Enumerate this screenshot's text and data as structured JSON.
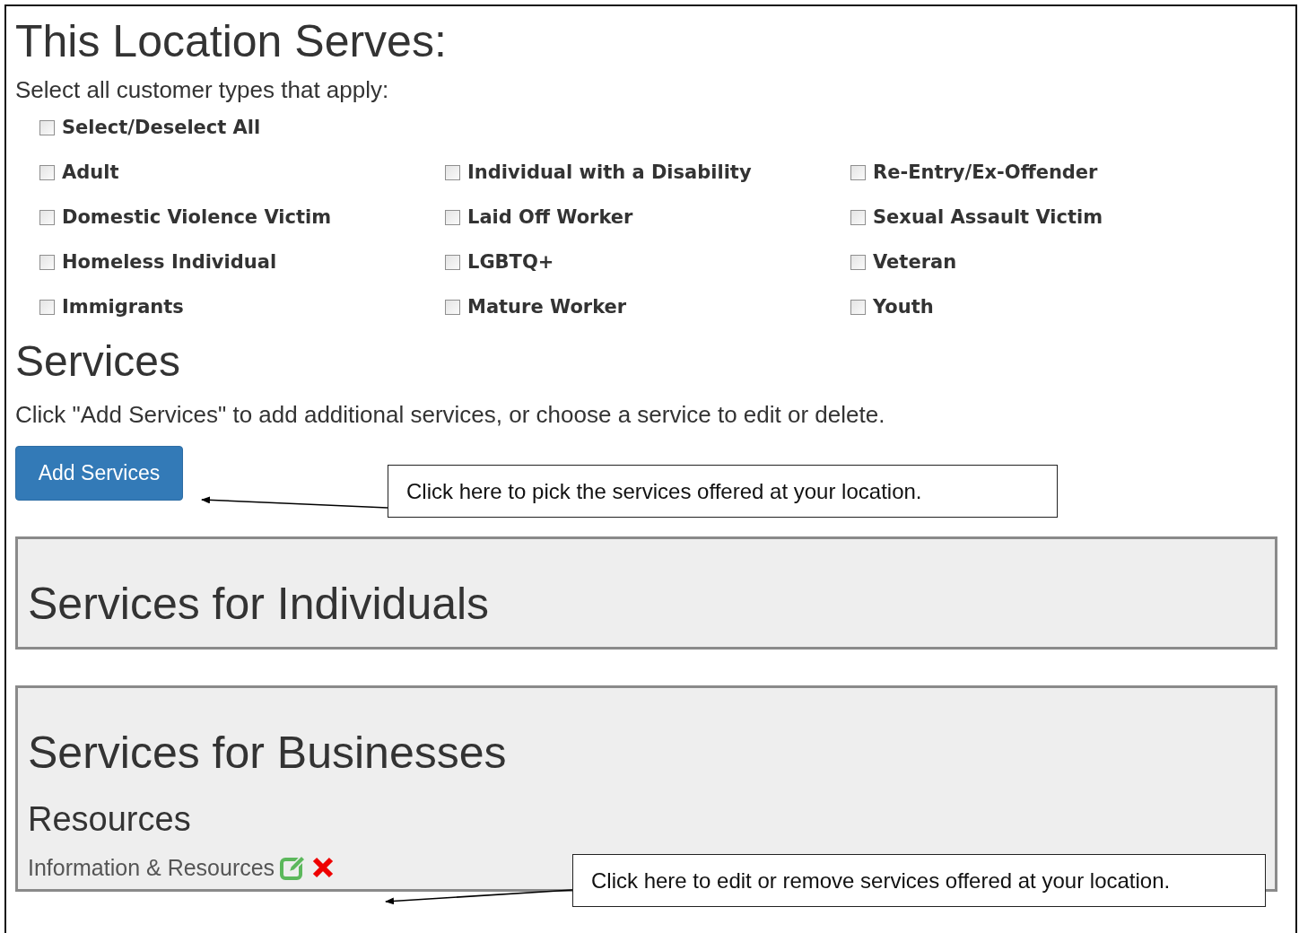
{
  "heading": "This Location Serves:",
  "instruction": "Select all customer types that apply:",
  "select_all": {
    "label": "Select/Deselect All",
    "checked": false
  },
  "customer_types": [
    {
      "label": "Adult",
      "checked": false
    },
    {
      "label": "Individual with a Disability",
      "checked": false
    },
    {
      "label": "Re-Entry/Ex-Offender",
      "checked": false
    },
    {
      "label": "Domestic Violence Victim",
      "checked": false
    },
    {
      "label": "Laid Off Worker",
      "checked": false
    },
    {
      "label": "Sexual Assault Victim",
      "checked": false
    },
    {
      "label": "Homeless Individual",
      "checked": false
    },
    {
      "label": "LGBTQ+",
      "checked": false
    },
    {
      "label": "Veteran",
      "checked": false
    },
    {
      "label": "Immigrants",
      "checked": false
    },
    {
      "label": "Mature Worker",
      "checked": false
    },
    {
      "label": "Youth",
      "checked": false
    }
  ],
  "services": {
    "heading": "Services",
    "instruction": "Click \"Add Services\" to add additional services, or choose a service to edit or delete.",
    "add_button": "Add Services"
  },
  "panels": [
    {
      "title": "Services for Individuals"
    },
    {
      "title": "Services for Businesses",
      "groups": [
        {
          "title": "Resources",
          "items": [
            {
              "label": "Information & Resources"
            }
          ]
        }
      ]
    }
  ],
  "callouts": [
    {
      "text": "Click here to pick the services offered at your location."
    },
    {
      "text": "Click here to edit or remove services offered at your location."
    }
  ]
}
